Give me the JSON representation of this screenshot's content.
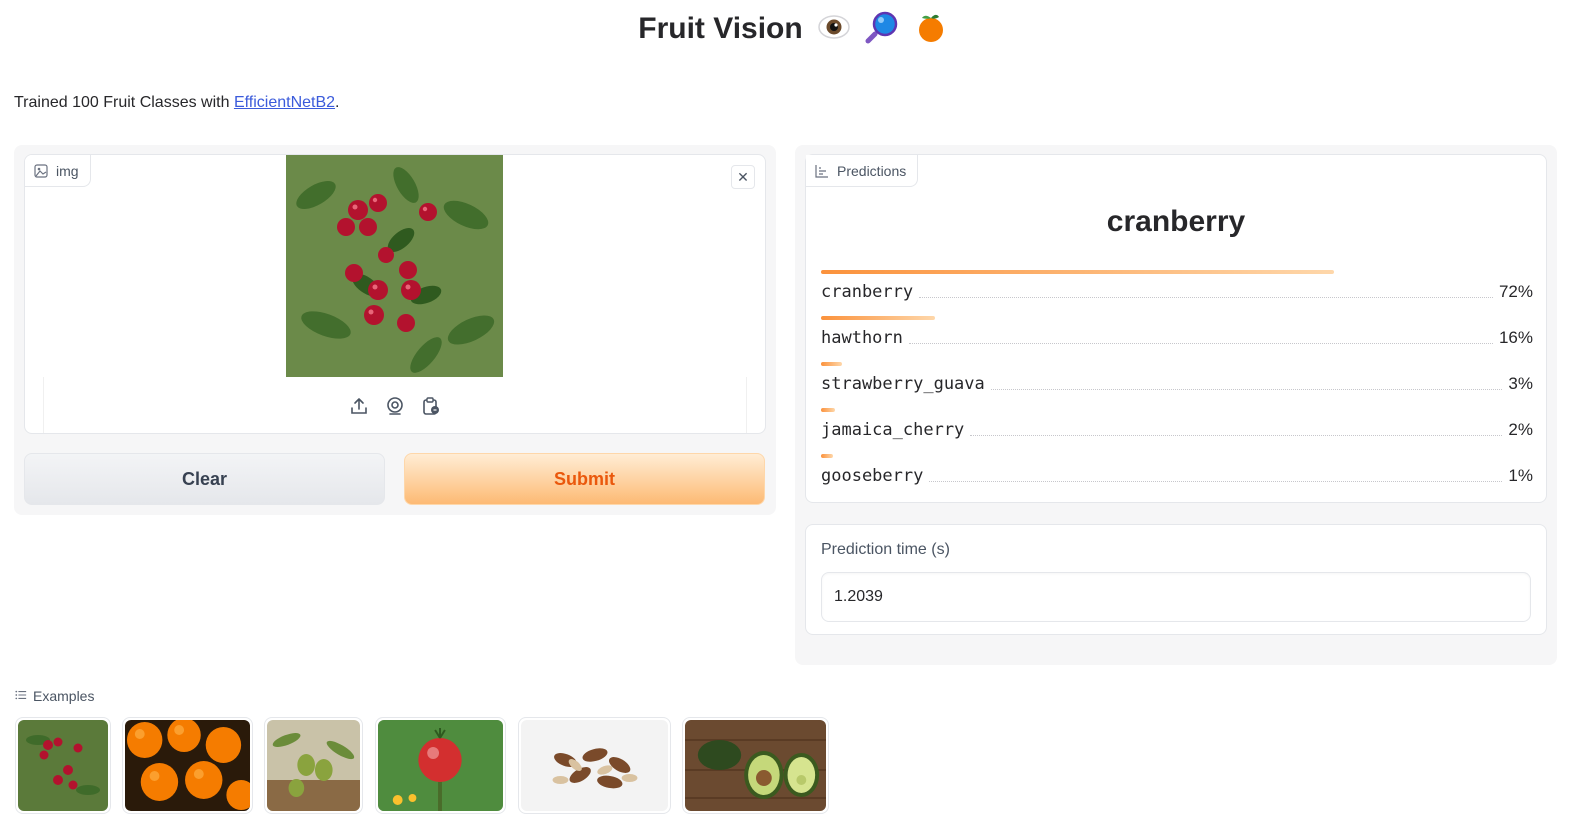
{
  "header": {
    "title": "Fruit Vision",
    "emojis": [
      "eye-icon",
      "magnifier-icon",
      "orange-icon"
    ]
  },
  "description": {
    "prefix": "Trained 100 Fruit Classes with ",
    "link_text": "EfficientNetB2",
    "suffix": "."
  },
  "input": {
    "label": "img",
    "image": "cranberry photo",
    "sources": [
      "upload-icon",
      "webcam-icon",
      "clipboard-icon"
    ]
  },
  "buttons": {
    "clear": "Clear",
    "submit": "Submit"
  },
  "predictions": {
    "label": "Predictions",
    "top_label": "cranberry",
    "items": [
      {
        "label": "cranberry",
        "pct": "72%",
        "value": 0.72
      },
      {
        "label": "hawthorn",
        "pct": "16%",
        "value": 0.16
      },
      {
        "label": "strawberry_guava",
        "pct": "3%",
        "value": 0.03
      },
      {
        "label": "jamaica_cherry",
        "pct": "2%",
        "value": 0.02
      },
      {
        "label": "gooseberry",
        "pct": "1%",
        "value": 0.01
      }
    ]
  },
  "timing": {
    "label": "Prediction time (s)",
    "value": "1.2039"
  },
  "examples": {
    "label": "Examples",
    "items": [
      "cranberry",
      "oranges",
      "olives",
      "rose-hip",
      "brazil-nuts",
      "avocado"
    ]
  },
  "colors": {
    "accent": "#fb923c",
    "link": "#3b5bdb",
    "submit_text": "#ea580c"
  }
}
